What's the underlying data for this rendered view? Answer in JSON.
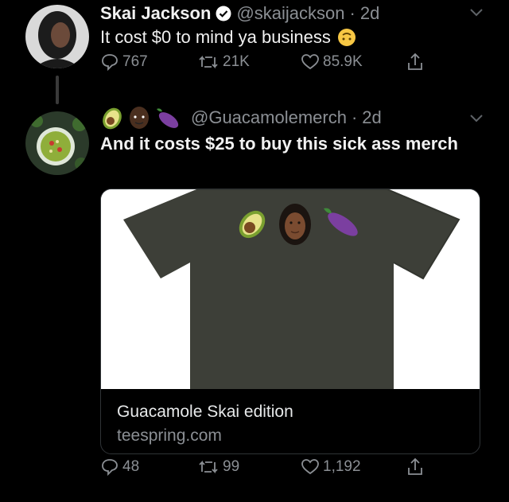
{
  "tweet1": {
    "name": "Skai Jackson",
    "handle": "@skaijackson",
    "time": "2d",
    "text": "It cost $0 to mind ya business",
    "replies": "767",
    "retweets": "21K",
    "likes": "85.9K"
  },
  "tweet2": {
    "handle": "@Guacamolemerch",
    "time": "2d",
    "text": "And it costs $25 to buy this sick ass merch",
    "replies": "48",
    "retweets": "99",
    "likes": "1,192",
    "card": {
      "title": "Guacamole Skai edition",
      "domain": "teespring.com"
    }
  },
  "colors": {
    "background": "#000000",
    "muted": "#8b8f94",
    "verified": "#ffffff",
    "shirt": "#3d3f38"
  },
  "icons": [
    "verified-badge-icon",
    "chevron-down-icon",
    "reply-icon",
    "retweet-icon",
    "like-icon",
    "share-icon",
    "avocado-icon",
    "face-icon",
    "eggplant-icon"
  ]
}
